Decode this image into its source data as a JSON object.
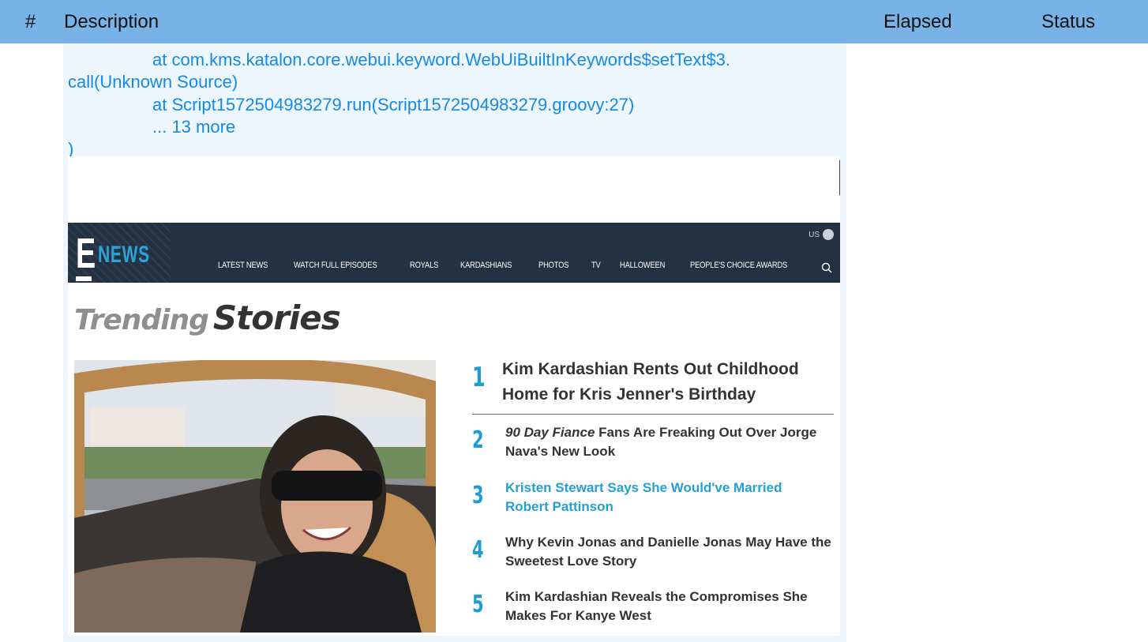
{
  "table_header": {
    "hash": "#",
    "description": "Description",
    "elapsed": "Elapsed",
    "status": "Status"
  },
  "log": {
    "line1": "at com.kms.katalon.core.webui.keyword.WebUiBuiltInKeywords$setText$3.",
    "line2": "call(Unknown Source)",
    "line3": "at Script1572504983279.run(Script1572504983279.groovy:27)",
    "line4": "... 13 more",
    "line5": ")"
  },
  "site": {
    "logo_letter": "E",
    "logo_word": "NEWS",
    "region": "US",
    "nav": [
      "LATEST NEWS",
      "WATCH FULL EPISODES",
      "ROYALS",
      "KARDASHIANS",
      "PHOTOS",
      "TV",
      "HALLOWEEN",
      "PEOPLE'S CHOICE AWARDS"
    ],
    "section_title_light": "Trending",
    "section_title_bold": "Stories",
    "stories": [
      {
        "num": "1",
        "title": "Kim Kardashian Rents Out Childhood Home for Kris Jenner's Birthday"
      },
      {
        "num": "2",
        "title_italic": "90 Day Fiance",
        "title": "Fans Are Freaking Out Over Jorge Nava's New Look"
      },
      {
        "num": "3",
        "title": "Kristen Stewart Says She Would've Married Robert Pattinson"
      },
      {
        "num": "4",
        "title": "Why Kevin Jonas and Danielle Jonas May Have the Sweetest Love Story"
      },
      {
        "num": "5",
        "title": "Kim Kardashian Reveals the Compromises She Makes For Kanye West"
      }
    ]
  },
  "colors": {
    "header_bg": "#77b3e7",
    "log_text": "#1689e6",
    "nav_bg": "#233142",
    "accent": "#1e9cd7"
  }
}
